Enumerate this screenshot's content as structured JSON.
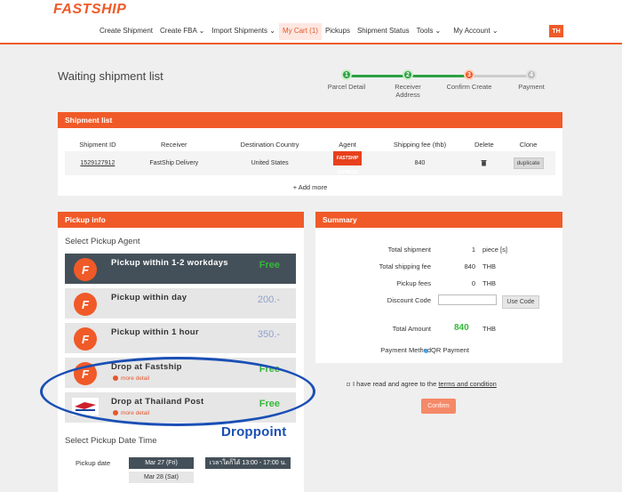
{
  "header": {
    "logo": "FASTSHIP",
    "nav": [
      {
        "label": "Create Shipment"
      },
      {
        "label": "Create FBA ⌄"
      },
      {
        "label": "Import Shipments ⌄"
      },
      {
        "label": "My Cart (1)"
      },
      {
        "label": "Pickups"
      },
      {
        "label": "Shipment Status"
      },
      {
        "label": "Tools ⌄"
      },
      {
        "label": "My Account ⌄"
      }
    ],
    "lang": "TH"
  },
  "page": {
    "title": "Waiting shipment list"
  },
  "steps": [
    {
      "num": "1",
      "label": "Parcel Detail",
      "status": "done"
    },
    {
      "num": "2",
      "label": "Receiver Address",
      "status": "done"
    },
    {
      "num": "3",
      "label": "Confirm Create",
      "status": "current"
    },
    {
      "num": "4",
      "label": "Payment",
      "status": "pending"
    }
  ],
  "shipment_list": {
    "title": "Shipment list",
    "columns": [
      "Shipment ID",
      "Receiver",
      "Destination Country",
      "Agent",
      "Shipping fee (thb)",
      "Delete",
      "Clone"
    ],
    "rows": [
      {
        "id": "1529127912",
        "receiver": "FastShip Delivery",
        "country": "United States",
        "agent": "FASTSHIP EXPRESS",
        "fee": "840",
        "clone": "duplicate"
      }
    ],
    "add_more": "+ Add more"
  },
  "pickup": {
    "title": "Pickup info",
    "select_agent": "Select Pickup Agent",
    "options": [
      {
        "title": "Pickup within 1-2 workdays",
        "price": "Free",
        "sub": ""
      },
      {
        "title": "Pickup within day",
        "price": "200.-",
        "sub": ""
      },
      {
        "title": "Pickup within 1 hour",
        "price": "350.-",
        "sub": ""
      },
      {
        "title": "Drop at Fastship",
        "price": "Free",
        "sub": "more detail"
      },
      {
        "title": "Drop at Thailand Post",
        "price": "Free",
        "sub": "more detail"
      }
    ],
    "select_date": "Select Pickup Date Time",
    "date_label": "Pickup date",
    "dates": [
      "Mar 27 (Fri)",
      "Mar 28 (Sat)"
    ],
    "time": "เวลาใดก็ได้ 13:00 - 17:00 น."
  },
  "annotation": {
    "text": "Droppoint",
    "color": "#1a4fb5"
  },
  "summary": {
    "title": "Summary",
    "total_shipment_label": "Total shipment",
    "total_shipment": "1",
    "total_shipment_unit": "piece [s]",
    "shipping_fee_label": "Total shipping fee",
    "shipping_fee": "840",
    "shipping_fee_unit": "THB",
    "pickup_fee_label": "Pickup fees",
    "pickup_fee": "0",
    "pickup_fee_unit": "THB",
    "discount_label": "Discount Code",
    "use_code": "Use Code",
    "total_amount_label": "Total Amount",
    "total_amount": "840",
    "total_amount_unit": "THB",
    "payment_method_label": "Payment Method",
    "payment_method": "QR Payment",
    "agree_text": "I have read and agree to the",
    "agree_link": "terms and condition",
    "confirm": "Confirm"
  },
  "colors": {
    "brand": "#f05a28",
    "done": "#2ea043",
    "dark": "#445059",
    "free": "#35b83a"
  }
}
